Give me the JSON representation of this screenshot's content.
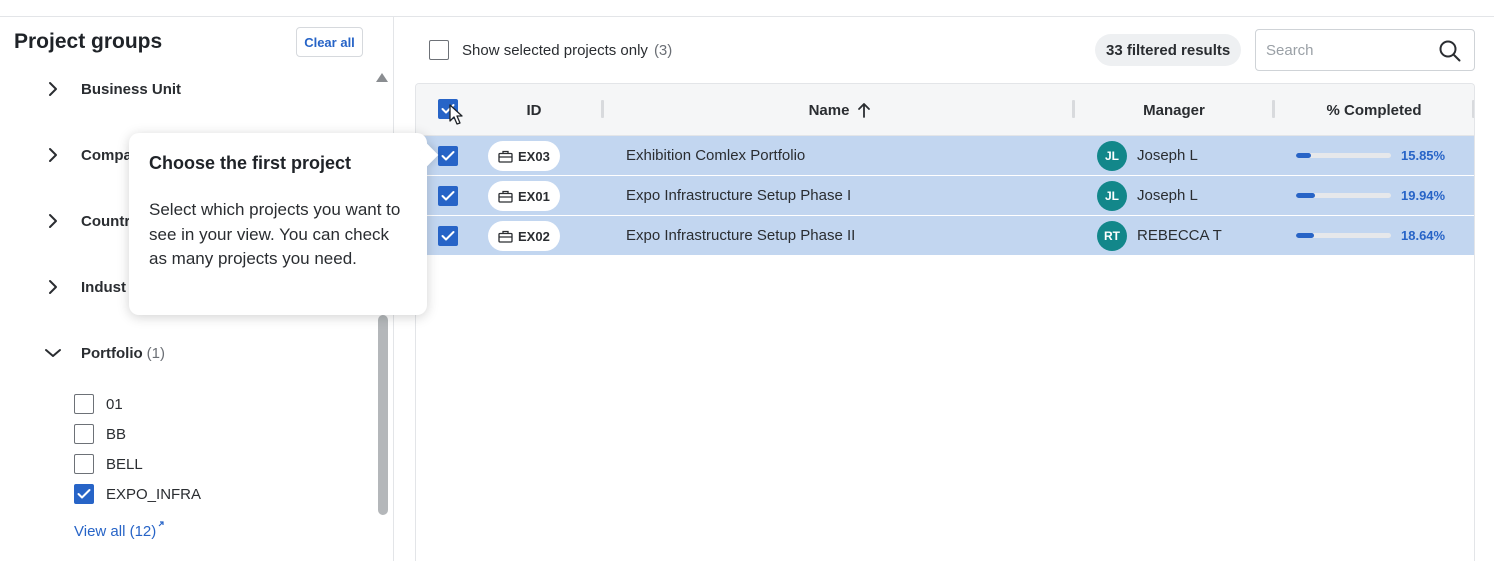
{
  "sidebar": {
    "title": "Project groups",
    "clear_label": "Clear all",
    "groups": [
      {
        "label": "Business Unit",
        "count": ""
      },
      {
        "label": "Compa",
        "count": ""
      },
      {
        "label": "Countr",
        "count": ""
      },
      {
        "label": "Indust",
        "count": ""
      },
      {
        "label": "Portfolio",
        "count": "(1)"
      }
    ],
    "portfolio_options": [
      {
        "label": "01",
        "checked": false
      },
      {
        "label": "BB",
        "checked": false
      },
      {
        "label": "BELL",
        "checked": false
      },
      {
        "label": "EXPO_INFRA",
        "checked": true
      }
    ],
    "view_all_label": "View all (12)",
    "view_all_icon": "external-link-icon"
  },
  "toolbar": {
    "show_selected_label": "Show selected projects only",
    "show_selected_count": "(3)",
    "results_label": "33 filtered results",
    "search_placeholder": "Search",
    "search_value": ""
  },
  "table": {
    "columns": [
      "ID",
      "Name",
      "Manager",
      "% Completed"
    ],
    "sort": {
      "column": "Name",
      "direction": "asc"
    },
    "rows": [
      {
        "id": "EX03",
        "name": "Exhibition Comlex Portfolio",
        "manager_initials": "JL",
        "manager": "Joseph L",
        "percent_label": "15.85%",
        "percent": 15.85,
        "checked": true
      },
      {
        "id": "EX01",
        "name": "Expo Infrastructure Setup Phase I",
        "manager_initials": "JL",
        "manager": "Joseph L",
        "percent_label": "19.94%",
        "percent": 19.94,
        "checked": true
      },
      {
        "id": "EX02",
        "name": "Expo Infrastructure Setup Phase II",
        "manager_initials": "RT",
        "manager": "REBECCA T",
        "percent_label": "18.64%",
        "percent": 18.64,
        "checked": true
      }
    ]
  },
  "tooltip": {
    "title": "Choose the first project",
    "body": "Select which projects you want to see in your view. You can check as many projects you need."
  },
  "colors": {
    "accent": "#2764c7",
    "row_selected": "#c2d6f0",
    "avatar": "#12878a"
  }
}
